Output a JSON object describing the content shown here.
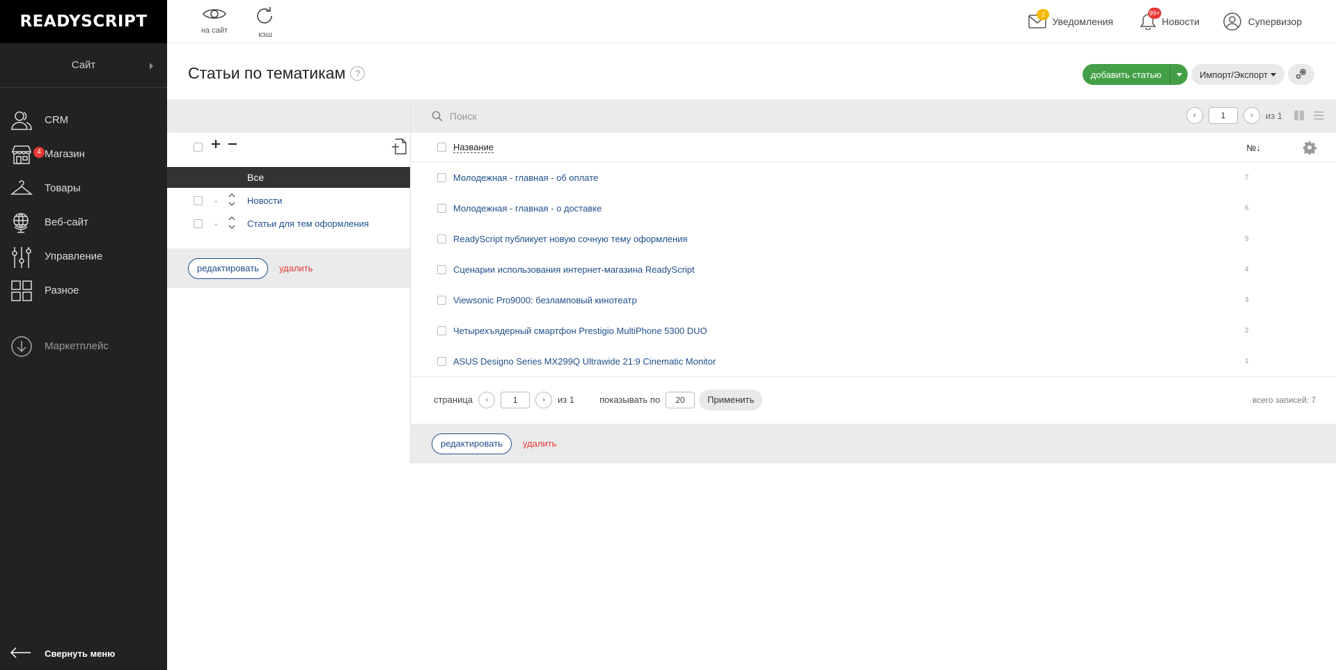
{
  "logo": "READYSCRIPT",
  "sidebar": {
    "site_label": "Сайт",
    "items": [
      {
        "label": "CRM"
      },
      {
        "label": "Магазин",
        "badge": "4"
      },
      {
        "label": "Товары"
      },
      {
        "label": "Веб-сайт"
      },
      {
        "label": "Управление"
      },
      {
        "label": "Разное"
      }
    ],
    "marketplace": "Маркетплейс",
    "collapse": "Свернуть меню"
  },
  "topbar": {
    "to_site": "на сайт",
    "cache": "кэш",
    "notifications": {
      "label": "Уведомления",
      "count": "2",
      "color": "#f5b800"
    },
    "news": {
      "label": "Новости",
      "count": "99+",
      "color": "#e53935"
    },
    "user": "Супервизор"
  },
  "page": {
    "title": "Статьи по тематикам",
    "help": "?",
    "add_button": "добавить статью",
    "import_export": "Импорт/Экспорт"
  },
  "tree": {
    "all": "Все",
    "items": [
      {
        "label": "Новости"
      },
      {
        "label": "Статьи для тем оформления"
      }
    ],
    "edit": "редактировать",
    "delete": "удалить"
  },
  "search": {
    "placeholder": "Поиск",
    "page": "1",
    "of": "из 1"
  },
  "table": {
    "col_name": "Название",
    "col_num": "№↓",
    "rows": [
      {
        "title": "Молодежная - главная - об оплате",
        "num": "7"
      },
      {
        "title": "Молодежная - главная - о доставке",
        "num": "6"
      },
      {
        "title": "ReadyScript публикует новую сочную тему оформления",
        "num": "5"
      },
      {
        "title": "Сценарии использования интернет-магазина ReadyScript",
        "num": "4"
      },
      {
        "title": "Viewsonic Pro9000: безламповый кинотеатр",
        "num": "3"
      },
      {
        "title": "Четырехъядерный смартфон Prestigio MultiPhone 5300 DUO",
        "num": "2"
      },
      {
        "title": "ASUS Designo Series MX299Q Ultrawide 21:9 Cinematic Monitor",
        "num": "1"
      }
    ]
  },
  "pager": {
    "page_label": "страница",
    "page": "1",
    "of": "из 1",
    "per_page_label": "показывать по",
    "per_page": "20",
    "apply": "Применить",
    "total": "всего записей: 7"
  },
  "footer": {
    "edit": "редактировать",
    "delete": "удалить"
  },
  "colors": {
    "accent_green": "#43a047",
    "link_blue": "#1e4f8a",
    "delete_red": "#e53935",
    "sidebar_bg": "#222222"
  }
}
